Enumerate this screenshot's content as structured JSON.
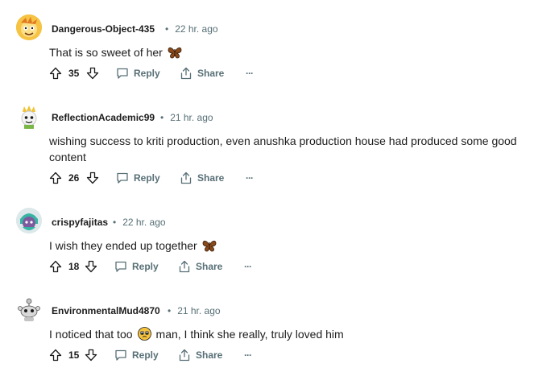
{
  "comments": [
    {
      "author": "Dangerous-Object-435",
      "time": "22 hr. ago",
      "text": "That is so sweet of her",
      "emoji": "butterfly-emoji",
      "votes": "35",
      "reply_label": "Reply",
      "share_label": "Share",
      "more_label": "···"
    },
    {
      "author": "ReflectionAcademic99",
      "time": "21 hr. ago",
      "text": "wishing success to kriti production, even anushka production house had produced some good content",
      "votes": "26",
      "reply_label": "Reply",
      "share_label": "Share",
      "more_label": "···"
    },
    {
      "author": "crispyfajitas",
      "time": "22 hr. ago",
      "text": "I wish they ended up together",
      "emoji": "butterfly-emoji",
      "votes": "18",
      "reply_label": "Reply",
      "share_label": "Share",
      "more_label": "···"
    },
    {
      "author": "EnvironmentalMud4870",
      "time": "21 hr. ago",
      "text_before": "I noticed that too",
      "text_after": "man, I think she really, truly loved him",
      "emoji": "pleading-face-emoji",
      "votes": "15",
      "reply_label": "Reply",
      "share_label": "Share",
      "more_label": "···"
    }
  ],
  "colors": {
    "text": "#1c1c1c",
    "meta": "#576f76",
    "butterfly": "#8a4a1c"
  }
}
